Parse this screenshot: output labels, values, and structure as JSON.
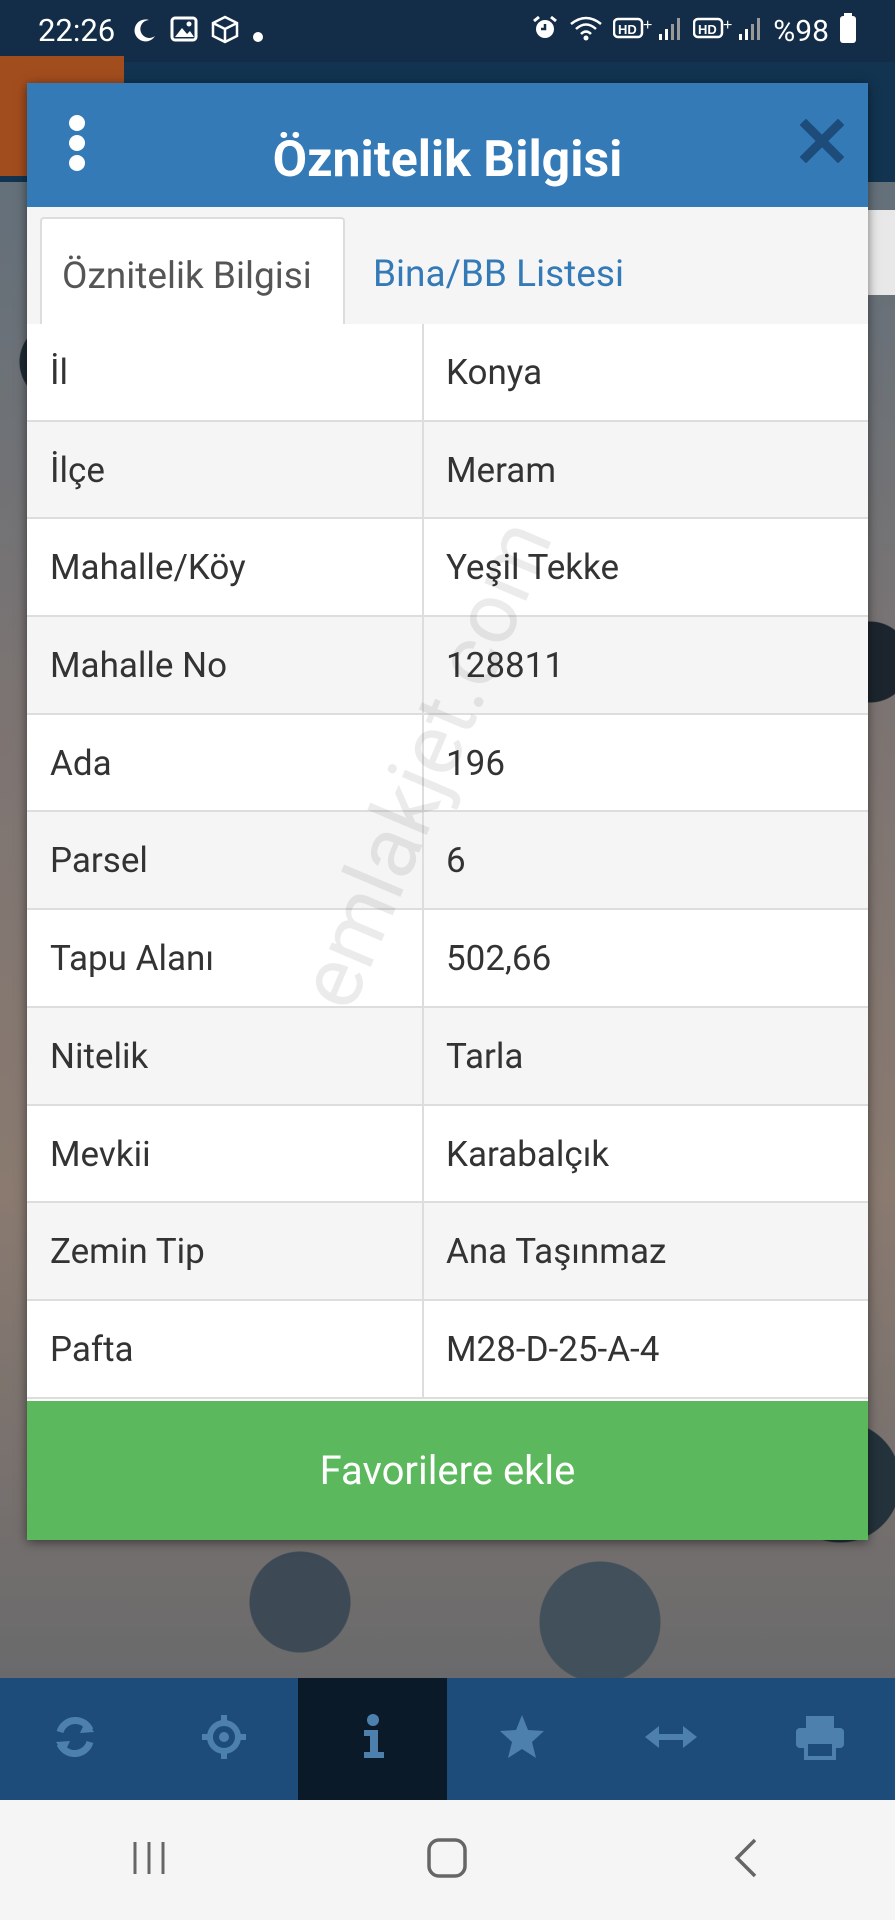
{
  "status_bar": {
    "time": "22:26",
    "battery": "%98",
    "left_icons": [
      "moon-icon",
      "gallery-icon",
      "box-icon",
      "dot-icon"
    ],
    "right_icons": [
      "alarm-icon",
      "wifi-icon",
      "hd-signal-1-icon",
      "hd-signal-2-icon",
      "battery-icon"
    ]
  },
  "modal": {
    "title": "Öznitelik Bilgisi",
    "tabs": [
      {
        "label": "Öznitelik Bilgisi",
        "active": true
      },
      {
        "label": "Bina/BB Listesi",
        "active": false
      }
    ],
    "rows": [
      {
        "key": "İl",
        "value": "Konya"
      },
      {
        "key": "İlçe",
        "value": "Meram"
      },
      {
        "key": "Mahalle/Köy",
        "value": "Yeşil Tekke"
      },
      {
        "key": "Mahalle No",
        "value": "128811"
      },
      {
        "key": "Ada",
        "value": "196"
      },
      {
        "key": "Parsel",
        "value": "6"
      },
      {
        "key": "Tapu Alanı",
        "value": "502,66"
      },
      {
        "key": "Nitelik",
        "value": "Tarla"
      },
      {
        "key": "Mevkii",
        "value": "Karabalçık"
      },
      {
        "key": "Zemin Tip",
        "value": "Ana Taşınmaz"
      },
      {
        "key": "Pafta",
        "value": "M28-D-25-A-4"
      }
    ],
    "favorite_button": "Favorilere ekle",
    "watermark": "emlakjet.com"
  },
  "toolbar": {
    "items": [
      "refresh-icon",
      "locate-icon",
      "info-icon",
      "star-icon",
      "measure-icon",
      "print-icon"
    ],
    "active_index": 2
  },
  "colors": {
    "header_blue": "#337ab7",
    "green_button": "#5cb85c",
    "toolbar_blue": "#1e4c7a",
    "status_bar": "#132c47"
  }
}
